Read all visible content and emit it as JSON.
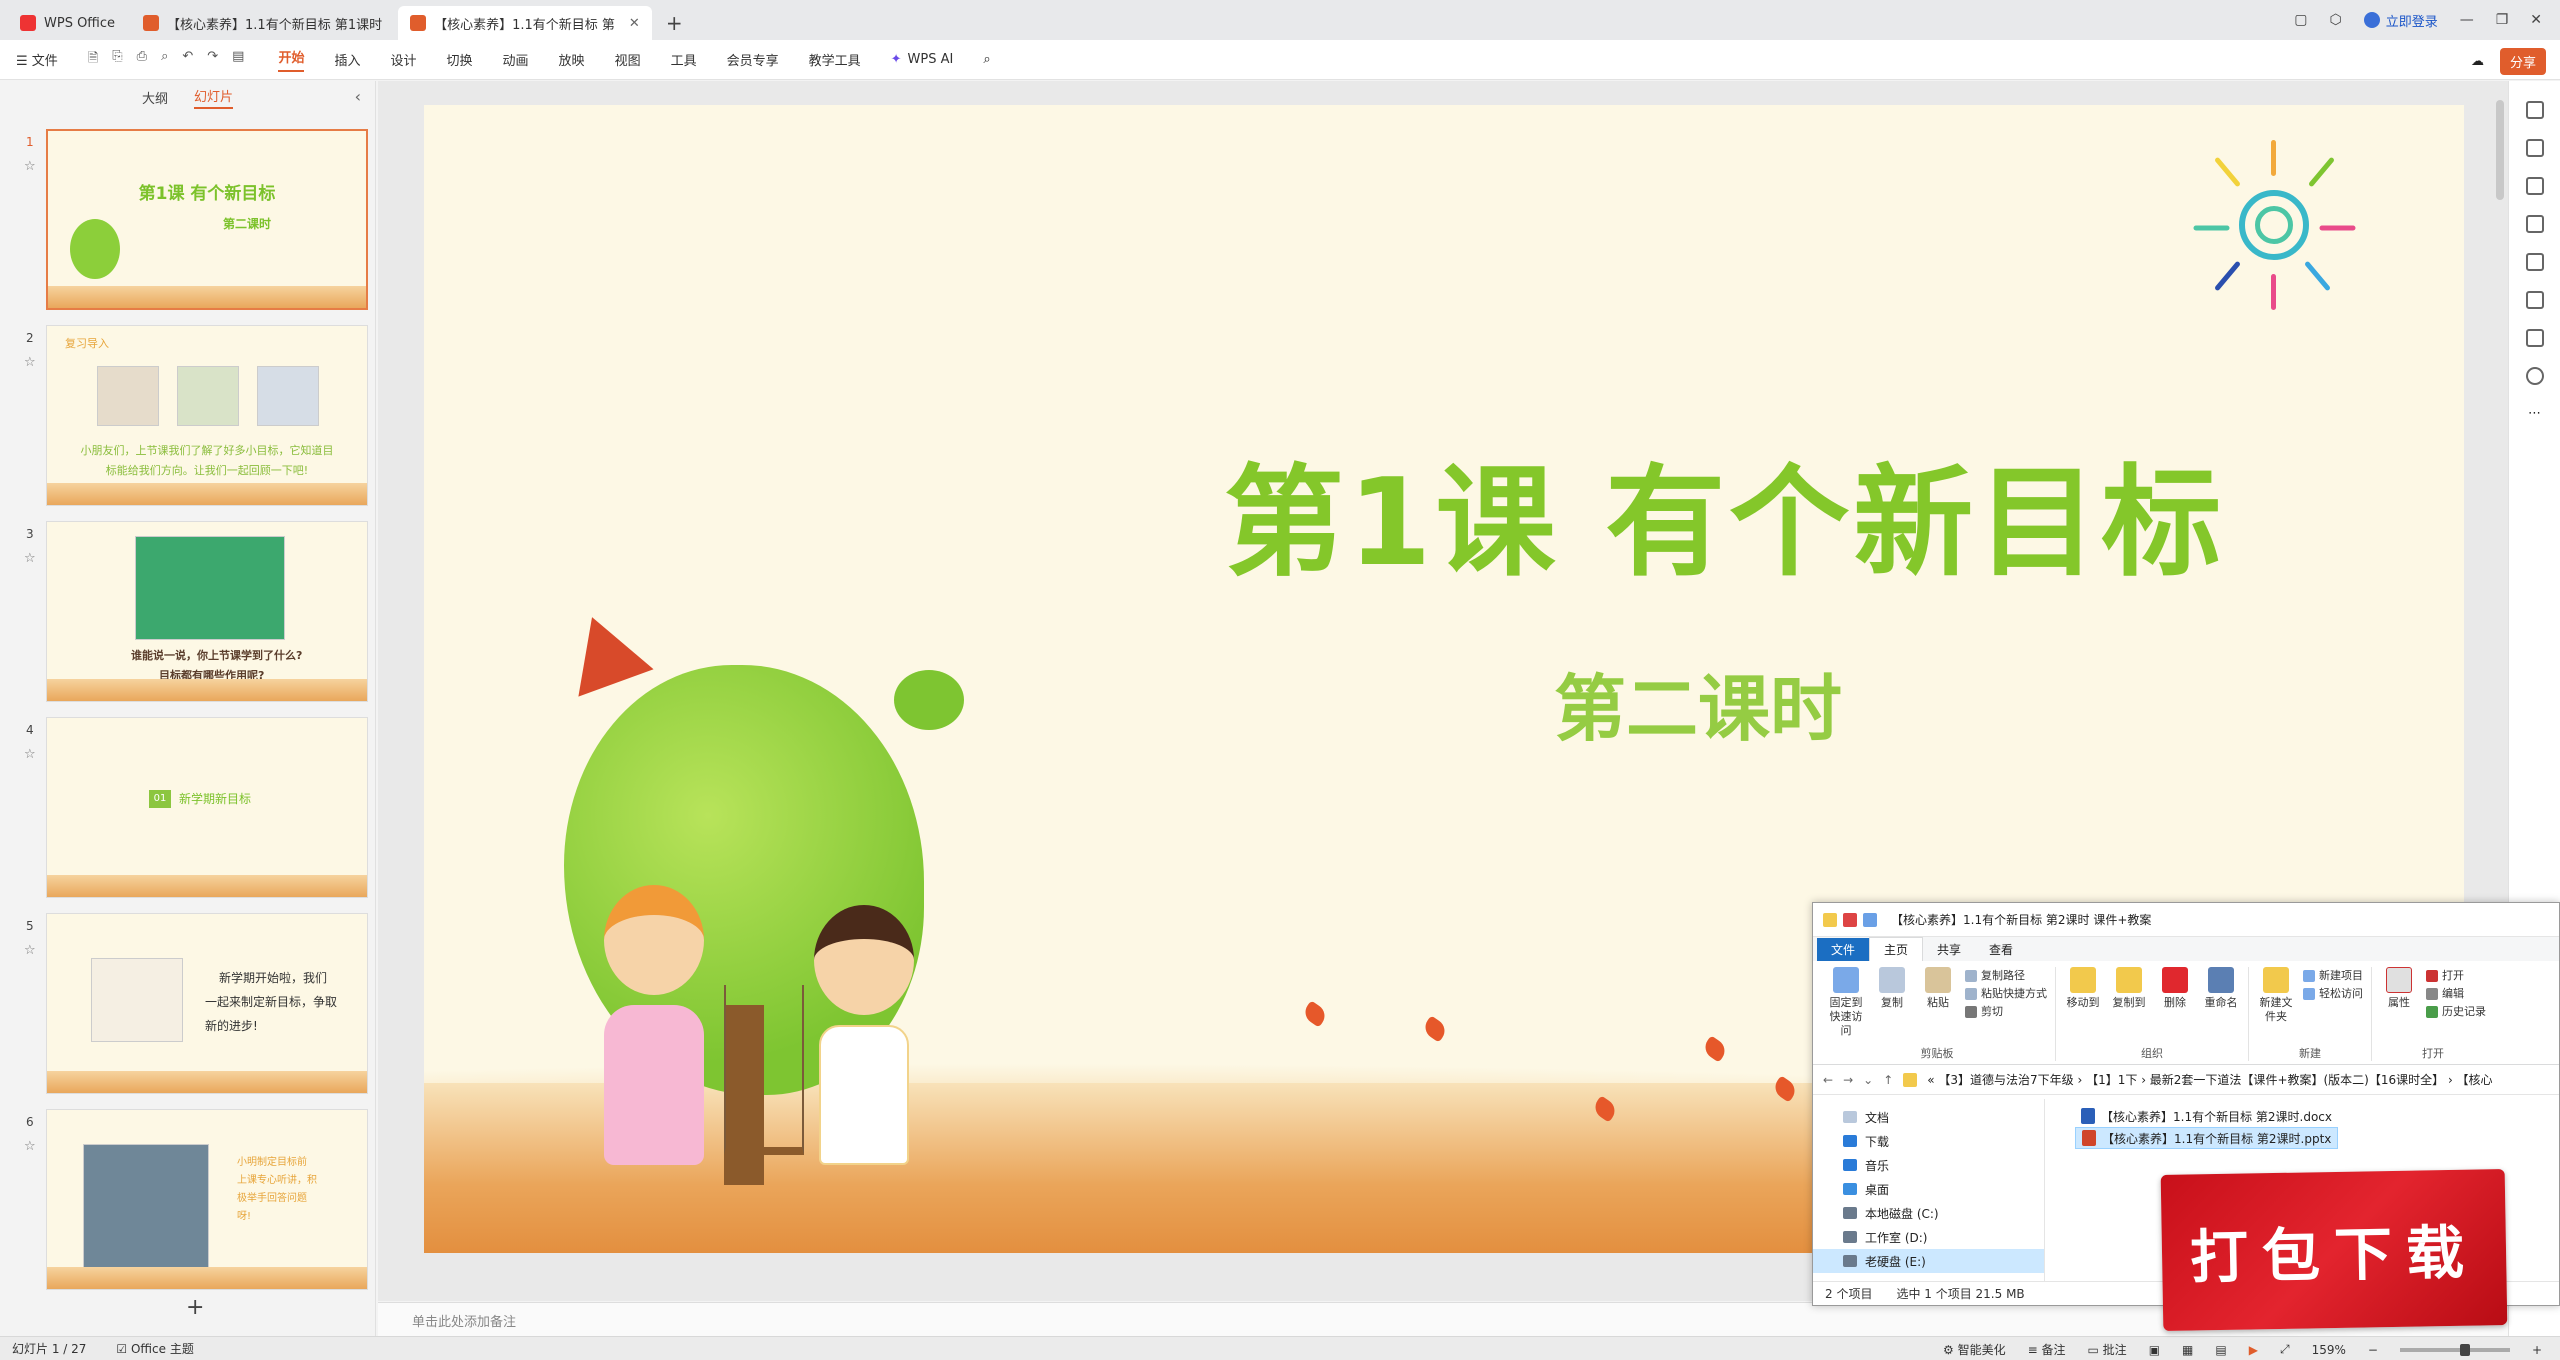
{
  "titlebar": {
    "home_tab": "WPS Office",
    "doc_tab_1": "【核心素养】1.1有个新目标 第1课时",
    "doc_tab_2": "【核心素养】1.1有个新目标 第",
    "login": "立即登录"
  },
  "menubar": {
    "file": "文件",
    "items": [
      "开始",
      "插入",
      "设计",
      "切换",
      "动画",
      "放映",
      "视图",
      "工具",
      "会员专享",
      "教学工具"
    ],
    "active": "开始",
    "wps_ai": "WPS AI",
    "share": "分享"
  },
  "leftpanel": {
    "tab_outline": "大纲",
    "tab_slides": "幻灯片",
    "slides": [
      {
        "num": "1",
        "title": "第1课  有个新目标",
        "sub": "第二课时"
      },
      {
        "num": "2",
        "heading": "复习导入",
        "text1": "小朋友们，上节课我们了解了好多小目标，它知道目",
        "text2": "标能给我们方向。让我们一起回顾一下吧!"
      },
      {
        "num": "3",
        "text1": "谁能说一说，你上节课学到了什么?",
        "text2": "目标都有哪些作用呢?"
      },
      {
        "num": "4",
        "badge": "01",
        "text": "新学期新目标"
      },
      {
        "num": "5",
        "text1": "新学期开始啦，我们",
        "text2": "一起来制定新目标，争取",
        "text3": "新的进步!"
      },
      {
        "num": "6",
        "text1": "小明制定目标前",
        "text2": "上课专心听讲，积",
        "text3": "极举手回答问题",
        "text4": "呀!"
      }
    ]
  },
  "slide": {
    "title": "第1课  有个新目标",
    "subtitle": "第二课时"
  },
  "notes_placeholder": "单击此处添加备注",
  "statusbar": {
    "slide_count": "幻灯片 1 / 27",
    "theme": "Office 主题",
    "beautify": "智能美化",
    "notes": "备注",
    "comments": "批注",
    "zoom": "159%"
  },
  "explorer": {
    "title": "【核心素养】1.1有个新目标 第2课时 课件+教案",
    "tabs": [
      "文件",
      "主页",
      "共享",
      "查看"
    ],
    "groups": {
      "clipboard": {
        "label": "剪贴板",
        "pin": "固定到快速访问",
        "copy": "复制",
        "paste": "粘贴",
        "copy_path": "复制路径",
        "paste_shortcut": "粘贴快捷方式",
        "cut": "剪切"
      },
      "organize": {
        "label": "组织",
        "move_to": "移动到",
        "copy_to": "复制到",
        "delete": "删除",
        "rename": "重命名"
      },
      "new": {
        "label": "新建",
        "new_folder": "新建文件夹",
        "new_item": "新建项目",
        "easy_access": "轻松访问"
      },
      "open": {
        "label": "打开",
        "properties": "属性",
        "open": "打开",
        "edit": "编辑",
        "history": "历史记录"
      }
    },
    "address": "« 【3】道德与法治7下年级 › 【1】1下 › 最新2套一下道法【课件+教案】(版本二)【16课时全】 › 【核心",
    "tree": [
      "文档",
      "下载",
      "音乐",
      "桌面",
      "本地磁盘 (C:)",
      "工作室 (D:)",
      "老硬盘 (E:)"
    ],
    "files": [
      "【核心素养】1.1有个新目标 第2课时.docx",
      "【核心素养】1.1有个新目标 第2课时.pptx"
    ],
    "status_items": "2 个项目",
    "status_selected": "选中 1 个项目  21.5 MB"
  },
  "stamp": "打包下载"
}
